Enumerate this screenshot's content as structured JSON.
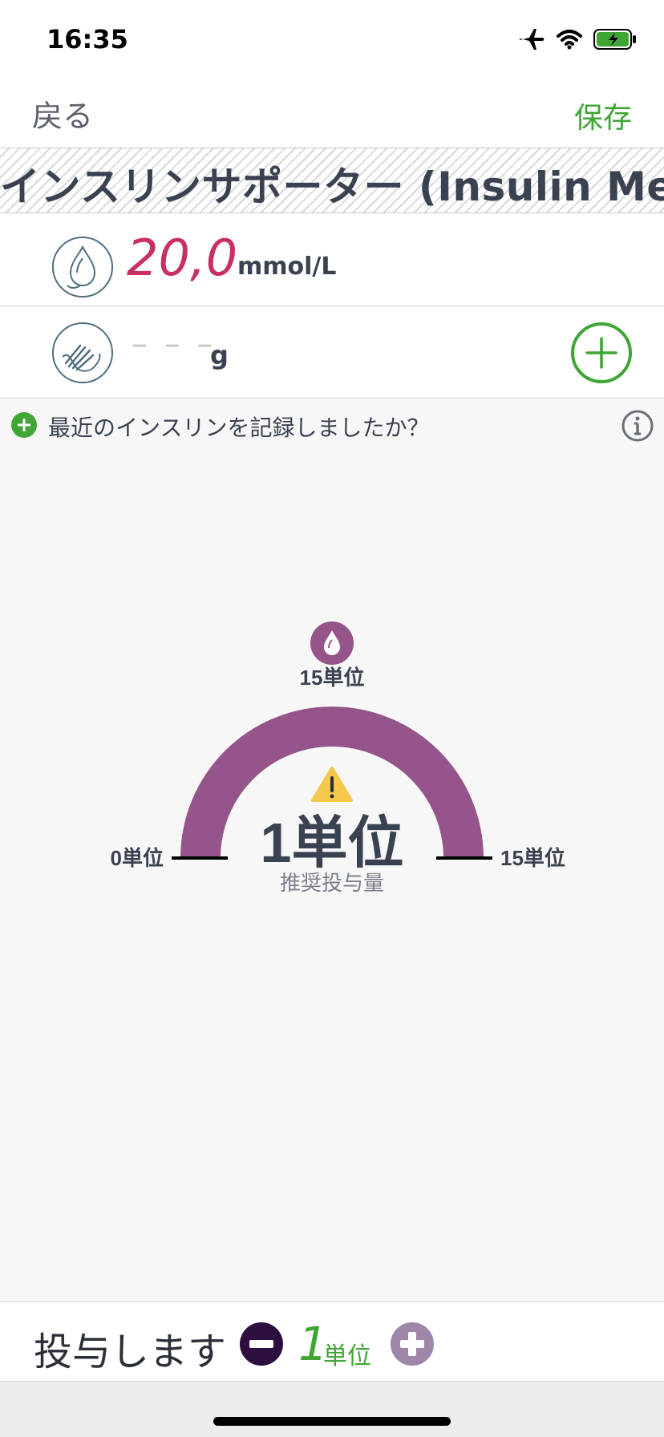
{
  "status_bar": {
    "time": "16:35",
    "battery_color": "#3fa535"
  },
  "nav": {
    "back_label": "戻る",
    "save_label": "保存"
  },
  "banner": {
    "title": "インスリンサポーター (Insulin Men"
  },
  "glucose": {
    "value": "20,0",
    "unit": "mmol/L",
    "icon": "blood-drop-icon",
    "value_color": "#c8305e"
  },
  "carbs": {
    "value": "– – –",
    "unit": "g",
    "icon": "hand-icon"
  },
  "recent": {
    "text": "最近のインスリンを記録しましたか？"
  },
  "gauge": {
    "max_label": "15単位",
    "min_label": "0単位",
    "right_label": "15単位",
    "dose_label": "1単位",
    "caption": "推奨投与量",
    "fill_fraction": 1.0,
    "color": "#96558a",
    "warning_color": "#f3c84b"
  },
  "dose": {
    "label": "投与します",
    "value": "1",
    "unit": "単位"
  },
  "colors": {
    "accent_green": "#3fa535",
    "text": "#3a4150",
    "background": "#f7f7f7"
  }
}
